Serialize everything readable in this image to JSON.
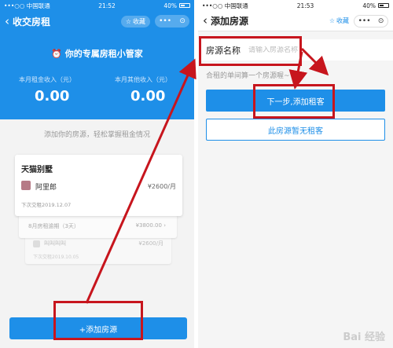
{
  "left": {
    "status": {
      "carrier": "•••○○ 中国联通",
      "time": "21:52",
      "battery": "40%"
    },
    "nav": {
      "back": "‹",
      "title": "收交房租",
      "favorite": "收藏",
      "more": "•••",
      "close": "⊙"
    },
    "hero": {
      "alarm_icon": "⏰",
      "title": "你的专属房租小管家",
      "income_label": "本月租金收入（元）",
      "income_value": "0.00",
      "other_label": "本月其他收入（元）",
      "other_value": "0.00"
    },
    "hint": "添加你的房源，轻松掌握租金情况",
    "card": {
      "title": "天猫别墅",
      "tenant": "阿里郎",
      "rent": "¥2600/月",
      "next_date": "下次交租2019.12.07"
    },
    "card2": {
      "left": "8月房租逾期（3天）",
      "right": "¥3800.00  ›"
    },
    "card3": {
      "name": "叫叫叫叫",
      "rent": "¥2600/月",
      "date": "下次交租2019.10.05"
    },
    "add_button": "+添加房源"
  },
  "right": {
    "status": {
      "carrier": "•••○○ 中国联通",
      "time": "21:53",
      "battery": "40%"
    },
    "nav": {
      "back": "‹",
      "title": "添加房源",
      "favorite": "收藏",
      "more": "•••",
      "close": "⊙"
    },
    "form": {
      "label": "房源名称",
      "placeholder": "请输入房源名称",
      "value": ""
    },
    "sub_hint": "合租的单间算一个房源喔~",
    "next_button": "下一步,添加租客",
    "no_tenant_button": "此房源暂无租客"
  },
  "annotation_color": "#c7151d",
  "brand_color": "#1e8fe8",
  "watermark": "Bai 经验"
}
